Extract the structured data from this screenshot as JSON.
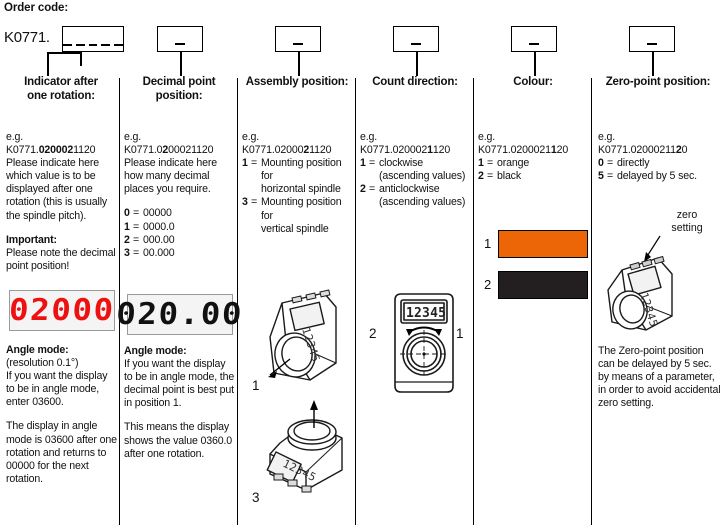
{
  "header": {
    "title": "Order code:",
    "prefix": "K0771.",
    "main_box_dashes": 5,
    "sub_box_dashes": 1
  },
  "columns": [
    {
      "id": "indicator-after-one-rotation",
      "title_line1": "Indicator after",
      "title_line2": "one rotation:",
      "example_label": "e.g.",
      "example_code_pre": "K0771.",
      "example_code_bold": "020002",
      "example_code_post": "1120",
      "description": "Please indicate here which value is to be displayed after one rotation (this is usually the spindle pitch).",
      "important_label": "Important:",
      "important_text": "Please note the decimal point position!",
      "display_value": "02000",
      "display_color": "#ee1111",
      "angle_mode_label": "Angle mode:",
      "angle_mode_resolution": "(resolution 0.1°)",
      "angle_mode_text": "If you want the display to be in angle mode, enter 03600.",
      "angle_mode_note": "The display in angle mode is 03600 after one rotation and returns to 00000 for the next rotation."
    },
    {
      "id": "decimal-point-position",
      "title_line1": "Decimal point position:",
      "title_line2": "",
      "example_label": "e.g.",
      "example_code_pre": "K0771.0",
      "example_code_bold": "2",
      "example_code_post": "00021120",
      "description": "Please indicate here how many decimal places you require.",
      "options": [
        {
          "key": "0",
          "value": "00000"
        },
        {
          "key": "1",
          "value": "0000.0"
        },
        {
          "key": "2",
          "value": "000.00"
        },
        {
          "key": "3",
          "value": "00.000"
        }
      ],
      "display_value": "020.00",
      "display_color": "#111111",
      "angle_mode_label": "Angle mode:",
      "angle_mode_text": "If you want the display to be in angle mode, the decimal point is best put in position 1.",
      "angle_mode_note": "This means the display shows the value 0360.0 after one rotation."
    },
    {
      "id": "assembly-position",
      "title_line1": "Assembly position:",
      "title_line2": "",
      "example_label": "e.g.",
      "example_code_pre": "K0771.02000",
      "example_code_bold": "2",
      "example_code_post": "1120",
      "options": [
        {
          "key": "1",
          "value": "Mounting position for",
          "cont": "horizontal spindle"
        },
        {
          "key": "3",
          "value": "Mounting position for",
          "cont": "vertical spindle"
        }
      ],
      "drawing1_label": "1",
      "drawing1_display": "12345",
      "drawing2_label": "3",
      "drawing2_display": "12345"
    },
    {
      "id": "count-direction",
      "title_line1": "Count direction:",
      "title_line2": "",
      "example_label": "e.g.",
      "example_code_pre": "K0771.020002",
      "example_code_bold": "1",
      "example_code_post": "120",
      "options": [
        {
          "key": "1",
          "value": "clockwise",
          "cont": "(ascending values)"
        },
        {
          "key": "2",
          "value": "anticlockwise",
          "cont": "(ascending values)"
        }
      ],
      "drawing_display": "12345",
      "drawing_label_left": "2",
      "drawing_label_right": "1"
    },
    {
      "id": "colour",
      "title_line1": "Colour:",
      "title_line2": "",
      "example_label": "e.g.",
      "example_code_pre": "K0771.0200021",
      "example_code_bold": "1",
      "example_code_post": "20",
      "options": [
        {
          "key": "1",
          "value": "orange"
        },
        {
          "key": "2",
          "value": "black"
        }
      ],
      "swatches": [
        {
          "label": "1",
          "color": "#ec6608"
        },
        {
          "label": "2",
          "color": "#231f20"
        }
      ]
    },
    {
      "id": "zero-point-position",
      "title_line1": "Zero-point position:",
      "title_line2": "",
      "example_label": "e.g.",
      "example_code_pre": "K0771.02000211",
      "example_code_bold": "2",
      "example_code_post": "0",
      "options": [
        {
          "key": "0",
          "value": "directly"
        },
        {
          "key": "5",
          "value": "delayed by 5 sec."
        }
      ],
      "callout_line1": "zero",
      "callout_line2": "setting",
      "drawing_display": "12345",
      "note": "The Zero-point position can be delayed by 5 sec. by means of a parameter, in order to avoid accidental zero setting."
    }
  ]
}
